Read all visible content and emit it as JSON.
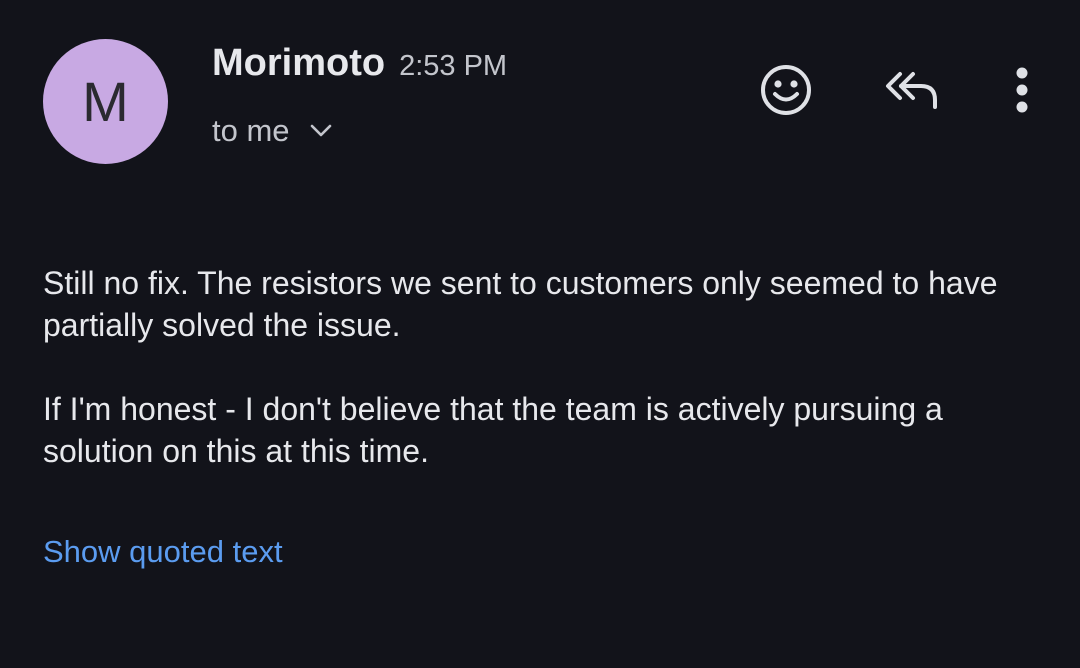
{
  "email": {
    "avatar_initial": "M",
    "avatar_color": "#c8a9e3",
    "sender_name": "Morimoto",
    "time": "2:53 PM",
    "recipient": "to me",
    "paragraphs": [
      "Still no fix. The resistors we sent to customers only seemed to have partially solved the issue.",
      "If I'm honest - I don't believe that the team is actively pursuing a solution on this at this time."
    ],
    "show_quoted_label": "Show quoted text",
    "link_color": "#5b9cf0"
  },
  "icons": {
    "details": "chevron-down-icon",
    "react": "emoji-smile-icon",
    "reply_all": "reply-all-icon",
    "more": "more-vert-icon"
  }
}
